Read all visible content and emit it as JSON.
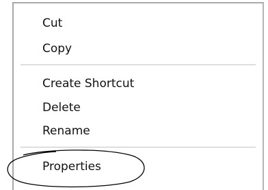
{
  "context_menu": {
    "items": [
      {
        "label": "Cut"
      },
      {
        "label": "Copy"
      },
      {
        "label": "Create Shortcut"
      },
      {
        "label": "Delete"
      },
      {
        "label": "Rename"
      },
      {
        "label": "Properties"
      }
    ]
  },
  "annotation": {
    "shape": "ellipse",
    "target": "Properties",
    "stroke_color": "#000000"
  }
}
